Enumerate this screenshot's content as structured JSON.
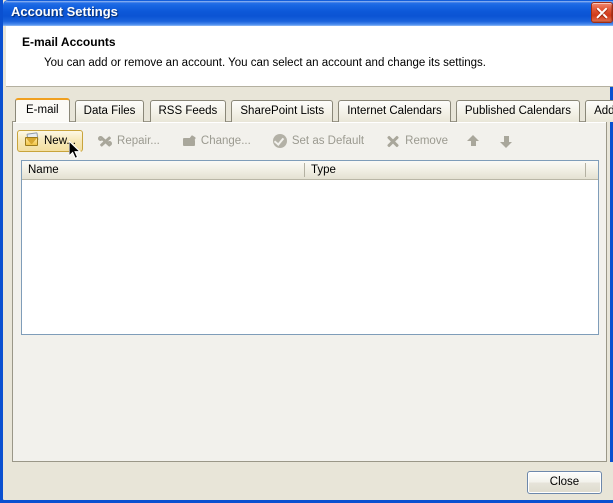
{
  "window": {
    "title": "Account Settings",
    "close_icon": "close-icon"
  },
  "header": {
    "title": "E-mail Accounts",
    "subtitle": "You can add or remove an account. You can select an account and change its settings."
  },
  "tabs": [
    {
      "label": "E-mail",
      "active": true
    },
    {
      "label": "Data Files",
      "active": false
    },
    {
      "label": "RSS Feeds",
      "active": false
    },
    {
      "label": "SharePoint Lists",
      "active": false
    },
    {
      "label": "Internet Calendars",
      "active": false
    },
    {
      "label": "Published Calendars",
      "active": false
    },
    {
      "label": "Address Books",
      "active": false
    }
  ],
  "toolbar": {
    "new_label": "New...",
    "repair_label": "Repair...",
    "change_label": "Change...",
    "set_default_label": "Set as Default",
    "remove_label": "Remove",
    "move_up_icon": "arrow-up-icon",
    "move_down_icon": "arrow-down-icon"
  },
  "list": {
    "columns": [
      "Name",
      "Type"
    ],
    "rows": []
  },
  "footer": {
    "close_label": "Close"
  }
}
